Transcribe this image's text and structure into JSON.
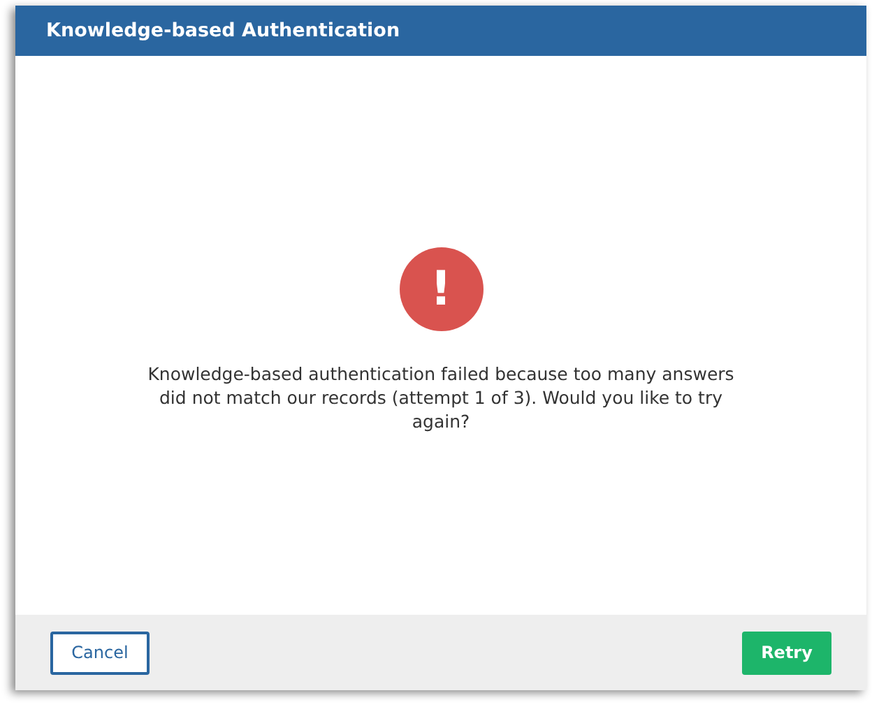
{
  "dialog": {
    "title": "Knowledge-based Authentication",
    "alert": {
      "icon": "!",
      "message": "Knowledge-based authentication failed because too many answers did not match our records (attempt 1 of 3). Would you like to try again?"
    },
    "buttons": [
      {
        "label": "Cancel",
        "kind": "secondary"
      },
      {
        "label": "Retry",
        "kind": "primary"
      }
    ]
  }
}
